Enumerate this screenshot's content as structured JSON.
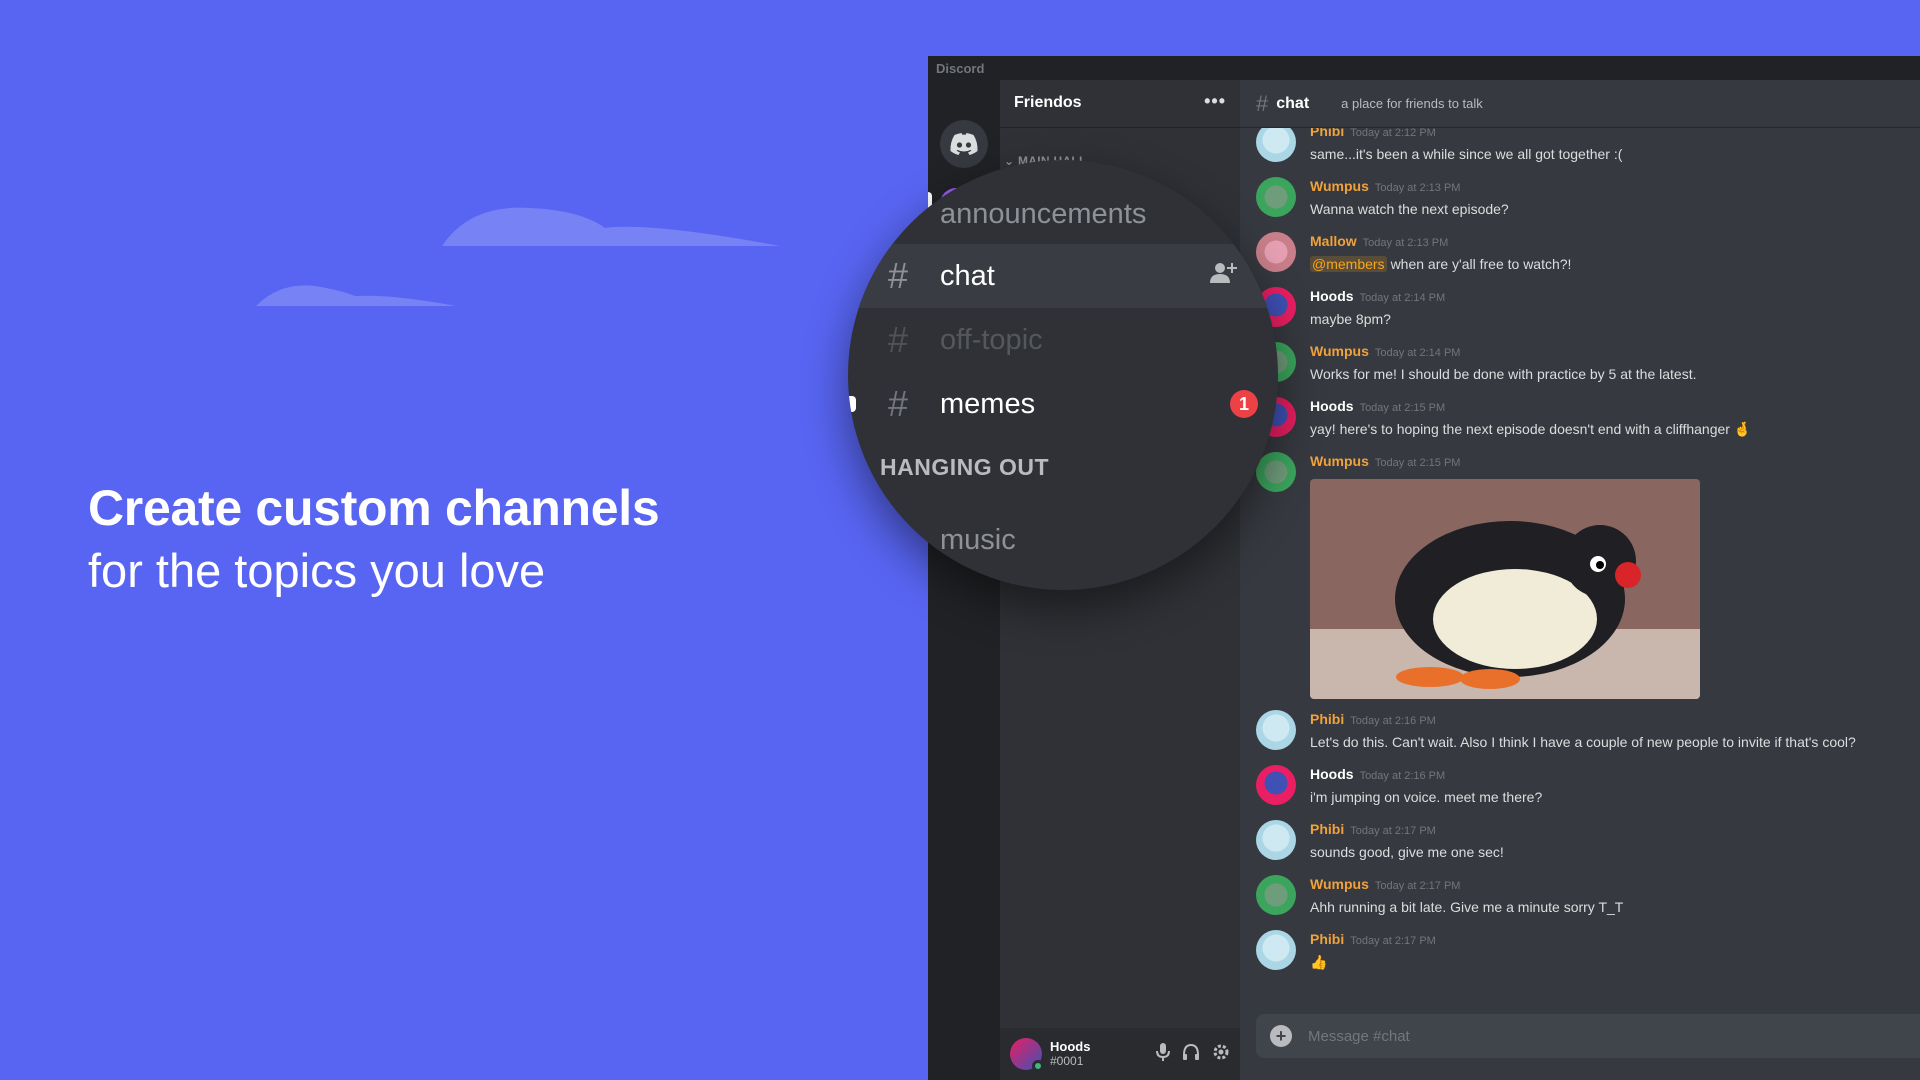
{
  "promo": {
    "headline": "Create custom channels",
    "subline": "for the topics you love"
  },
  "app": {
    "title": "Discord",
    "server_name": "Friendos",
    "menu_label": "•••",
    "sidebar_category": "MAIN HALL"
  },
  "magnifier": {
    "channels": [
      {
        "name": "announcements",
        "state": "normal"
      },
      {
        "name": "chat",
        "state": "active"
      },
      {
        "name": "off-topic",
        "state": "muted"
      },
      {
        "name": "memes",
        "state": "unread",
        "badge": "1"
      }
    ],
    "category": "HANGING OUT",
    "category_channels": [
      {
        "name": "music",
        "state": "normal"
      }
    ]
  },
  "chat": {
    "channel": "chat",
    "topic": "a place for friends to talk",
    "composer_placeholder": "Message #chat",
    "messages": [
      {
        "author": "Phibi",
        "time": "Today at 2:12 PM",
        "text": "same...it's been a while since we all got together :("
      },
      {
        "author": "Wumpus",
        "time": "Today at 2:13 PM",
        "text": "Wanna watch the next episode?"
      },
      {
        "author": "Mallow",
        "time": "Today at 2:13 PM",
        "mention": "@members",
        "text": "when are y'all free to watch?!"
      },
      {
        "author": "Hoods",
        "time": "Today at 2:14 PM",
        "text": "maybe 8pm?"
      },
      {
        "author": "Wumpus",
        "time": "Today at 2:14 PM",
        "text": "Works for me! I should be done with practice by 5 at the latest."
      },
      {
        "author": "Hoods",
        "time": "Today at 2:15 PM",
        "text": "yay! here's to hoping the next episode doesn't end with a cliffhanger 🤞"
      },
      {
        "author": "Wumpus",
        "time": "Today at 2:15 PM",
        "text": ""
      },
      {
        "author": "Phibi",
        "time": "Today at 2:16 PM",
        "text": "Let's do this. Can't wait. Also I think I have a couple of new people to invite if that's cool?"
      },
      {
        "author": "Hoods",
        "time": "Today at 2:16 PM",
        "text": "i'm jumping on voice. meet me there?"
      },
      {
        "author": "Phibi",
        "time": "Today at 2:17 PM",
        "text": "sounds good, give me one sec!"
      },
      {
        "author": "Wumpus",
        "time": "Today at 2:17 PM",
        "text": "Ahh running a bit late. Give me a minute sorry T_T"
      },
      {
        "author": "Phibi",
        "time": "Today at 2:17 PM",
        "text": "👍"
      }
    ]
  },
  "user": {
    "name": "Hoods",
    "tag": "#0001"
  },
  "icons": {
    "home": "discord-logo-icon",
    "mic": "microphone-icon",
    "headset": "headphones-icon",
    "settings": "gear-icon",
    "add": "plus-icon",
    "invite": "add-member-icon"
  },
  "colors": {
    "brand": "#5865f2",
    "unread_badge": "#ed4245",
    "author_name": "#f0a23b"
  }
}
